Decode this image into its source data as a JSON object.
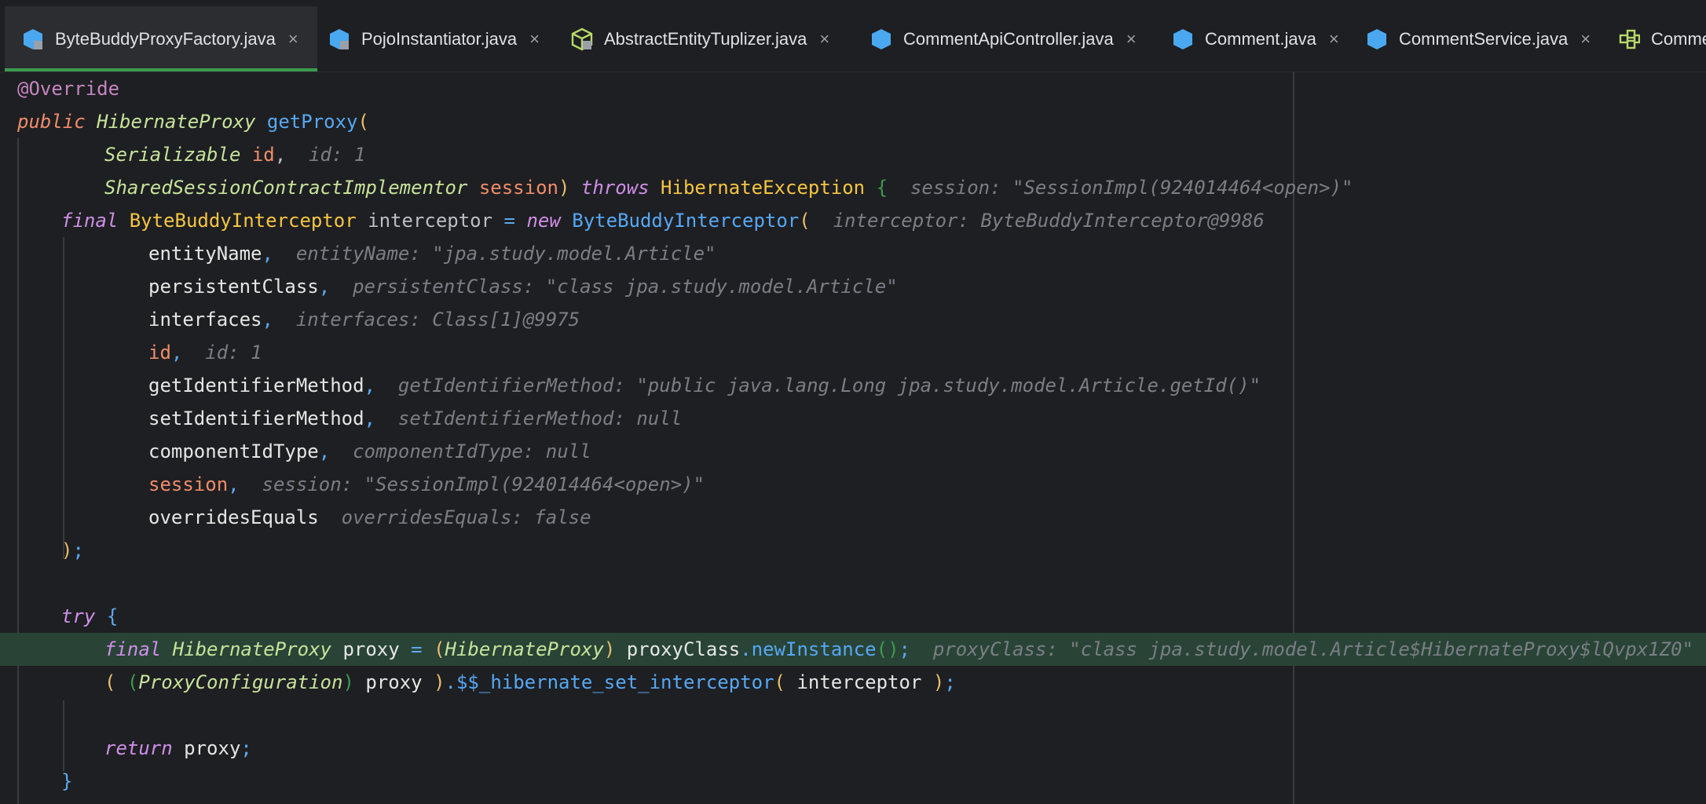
{
  "tabs": [
    {
      "label": "ByteBuddyProxyFactory.java",
      "icon": "java-class-icon",
      "active": true,
      "close": "×"
    },
    {
      "label": "PojoInstantiator.java",
      "icon": "java-class-icon",
      "active": false,
      "close": "×"
    },
    {
      "label": "AbstractEntityTuplizer.java",
      "icon": "abstract-class-icon",
      "active": false,
      "close": "×"
    },
    {
      "label": "CommentApiController.java",
      "icon": "java-class-icon",
      "active": false,
      "close": "×"
    },
    {
      "label": "Comment.java",
      "icon": "java-class-icon",
      "active": false,
      "close": "×"
    },
    {
      "label": "CommentService.java",
      "icon": "java-class-icon",
      "active": false,
      "close": "×"
    },
    {
      "label": "Comme",
      "icon": "structure-icon",
      "active": false,
      "close": ""
    }
  ],
  "code": {
    "l1": {
      "ann": "@Override"
    },
    "l2": {
      "kw": "public",
      "type": "HibernateProxy",
      "fn": "getProxy",
      "paren": "("
    },
    "l3": {
      "type": "Serializable",
      "param": "id",
      "comma": ",",
      "hint": "id: 1"
    },
    "l4": {
      "type": "SharedSessionContractImplementor",
      "param": "session",
      "paren": ")",
      "kw": "throws",
      "exc": "HibernateException",
      "brace": "{",
      "hint_name": "session:",
      "hint_val": "\"SessionImpl(924014464<open>)\""
    },
    "l5": {
      "kw": "final",
      "type": "ByteBuddyInterceptor",
      "var": "interceptor",
      "eq": "=",
      "kw2": "new",
      "ctor": "ByteBuddyInterceptor",
      "paren": "(",
      "hint_name": "interceptor:",
      "hint_val": "ByteBuddyInterceptor@9986"
    },
    "l6": {
      "arg": "entityName",
      "comma": ",",
      "hint_name": "entityName:",
      "hint_val": "\"jpa.study.model.Article\""
    },
    "l7": {
      "arg": "persistentClass",
      "comma": ",",
      "hint_name": "persistentClass:",
      "hint_val": "\"class jpa.study.model.Article\""
    },
    "l8": {
      "arg": "interfaces",
      "comma": ",",
      "hint_name": "interfaces:",
      "hint_val": "Class[1]@9975"
    },
    "l9": {
      "arg": "id",
      "comma": ",",
      "hint_name": "id:",
      "hint_val": "1"
    },
    "l10": {
      "arg": "getIdentifierMethod",
      "comma": ",",
      "hint_name": "getIdentifierMethod:",
      "hint_val": "\"public java.lang.Long jpa.study.model.Article.getId()\""
    },
    "l11": {
      "arg": "setIdentifierMethod",
      "comma": ",",
      "hint_name": "setIdentifierMethod:",
      "hint_val": "null"
    },
    "l12": {
      "arg": "componentIdType",
      "comma": ",",
      "hint_name": "componentIdType:",
      "hint_val": "null"
    },
    "l13": {
      "arg": "session",
      "comma": ",",
      "hint_name": "session:",
      "hint_val": "\"SessionImpl(924014464<open>)\""
    },
    "l14": {
      "arg": "overridesEquals",
      "hint_name": "overridesEquals:",
      "hint_val": "false"
    },
    "l15": {
      "paren": ")",
      "semi": ";"
    },
    "l17": {
      "kw": "try",
      "brace": "{"
    },
    "l18": {
      "kw": "final",
      "type": "HibernateProxy",
      "var": "proxy",
      "eq": "=",
      "po": "(",
      "cast": "HibernateProxy",
      "pc": ")",
      "obj": "proxyClass",
      "dot": ".",
      "method": "newInstance",
      "call": "()",
      "semi": ";",
      "hint_name": "proxyClass:",
      "hint_val": "\"class jpa.study.model.Article$HibernateProxy$lQvpx1Z0\""
    },
    "l19": {
      "po": "(",
      "po2": "(",
      "cast": "ProxyConfiguration",
      "pc2": ")",
      "var": "proxy",
      "pc": ")",
      "dot": ".",
      "method": "$$_hibernate_set_interceptor",
      "mo": "(",
      "arg": "interceptor",
      "mc": ")",
      "semi": ";"
    },
    "l21": {
      "kw": "return",
      "var": "proxy",
      "semi": ";"
    },
    "l22": {
      "brace": "}"
    }
  }
}
